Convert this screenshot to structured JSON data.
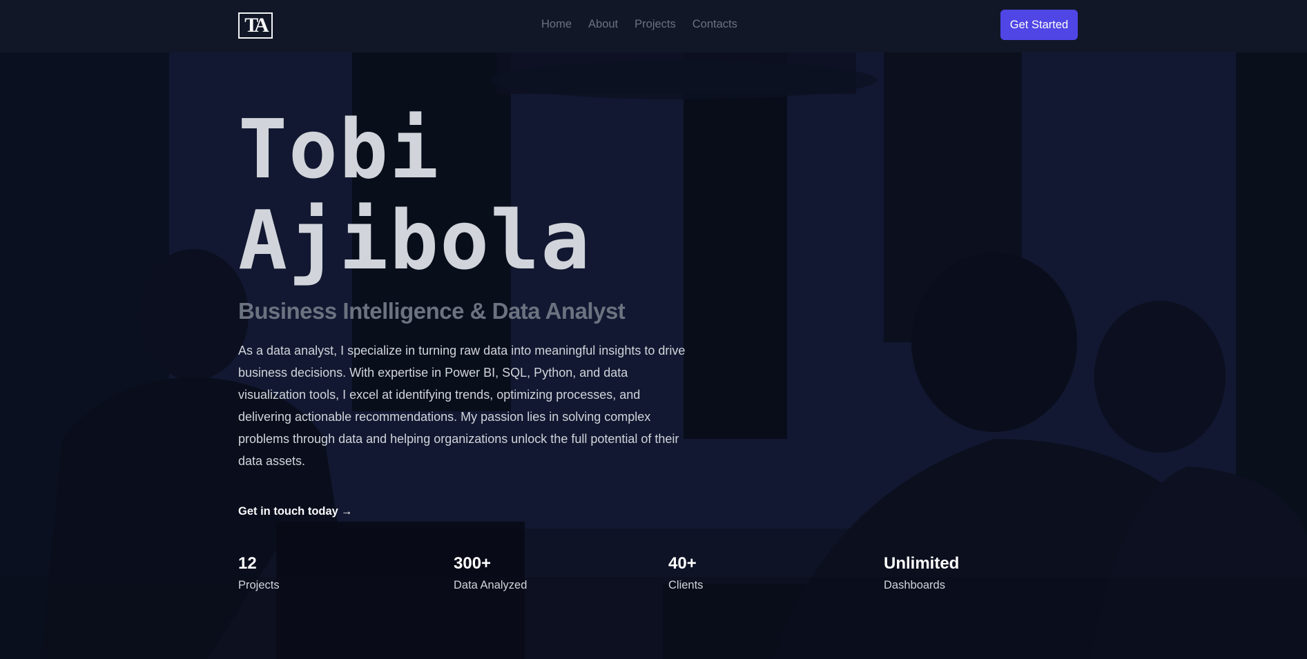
{
  "header": {
    "logo_text": "TA",
    "nav": [
      {
        "label": "Home"
      },
      {
        "label": "About"
      },
      {
        "label": "Projects"
      },
      {
        "label": "Contacts"
      }
    ],
    "cta_label": "Get Started"
  },
  "hero": {
    "name_line1": "Tobi",
    "name_line2": "Ajibola",
    "subtitle": "Business Intelligence & Data Analyst",
    "description": "As a data analyst, I specialize in turning raw data into meaningful insights to drive business decisions. With expertise in Power BI, SQL, Python, and data visualization tools, I excel at identifying trends, optimizing processes, and delivering actionable recommendations. My passion lies in solving complex problems through data and helping organizations unlock the full potential of their data assets.",
    "link_label": "Get in touch today",
    "link_arrow": "→"
  },
  "stats": [
    {
      "value": "12",
      "label": "Projects"
    },
    {
      "value": "300+",
      "label": "Data Analyzed"
    },
    {
      "value": "40+",
      "label": "Clients"
    },
    {
      "value": "Unlimited",
      "label": "Dashboards"
    }
  ],
  "colors": {
    "accent": "#4f46e5",
    "background": "#111727",
    "nav_text": "#6b7280"
  }
}
